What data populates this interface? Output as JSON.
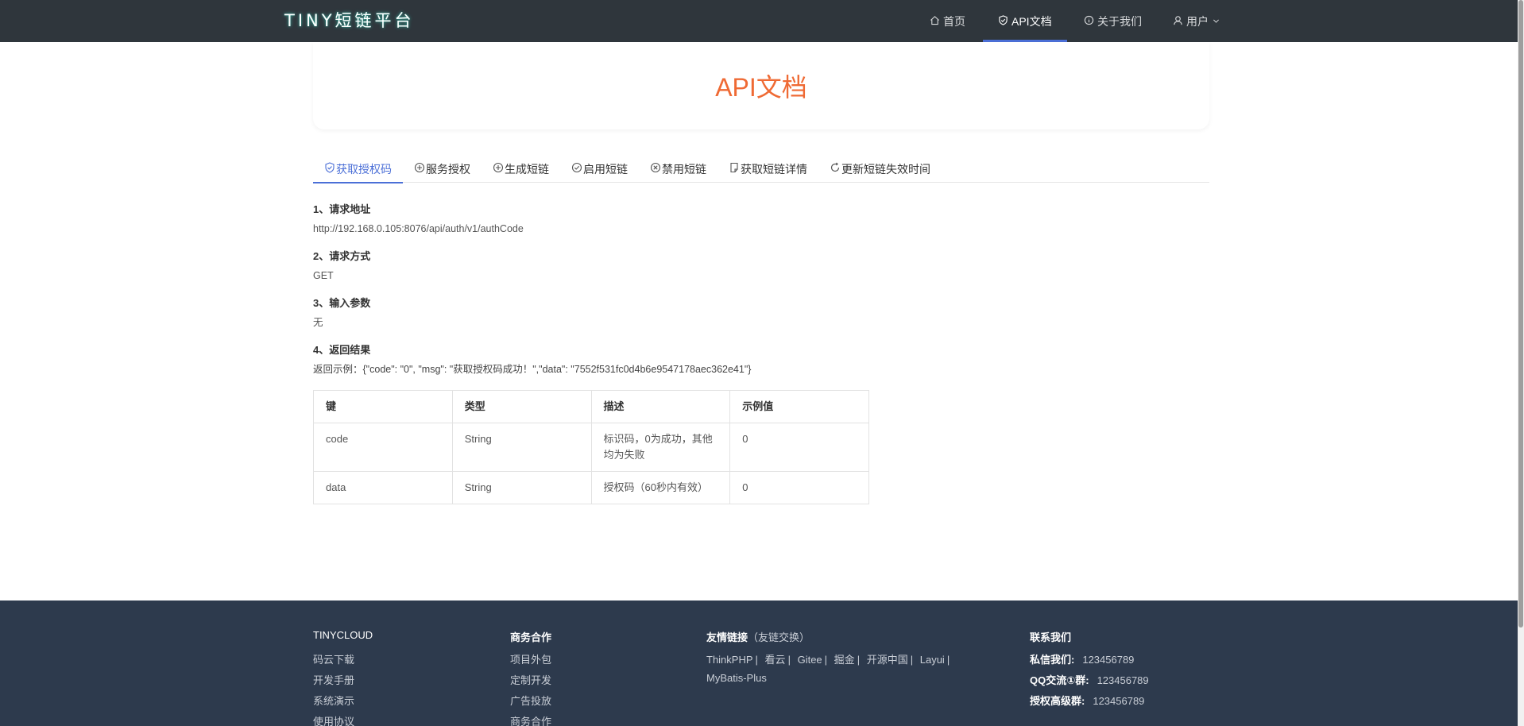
{
  "header": {
    "logo": "TINY短链平台",
    "nav": [
      {
        "label": "首页",
        "icon": "home-icon"
      },
      {
        "label": "API文档",
        "icon": "shield-check-icon",
        "active": true
      },
      {
        "label": "关于我们",
        "icon": "info-icon"
      },
      {
        "label": "用户",
        "icon": "user-icon"
      }
    ]
  },
  "page": {
    "title": "API文档"
  },
  "tabs": [
    {
      "label": "获取授权码",
      "icon": "shield-check-icon",
      "active": true
    },
    {
      "label": "服务授权",
      "icon": "plus-circle-icon"
    },
    {
      "label": "生成短链",
      "icon": "plus-circle-icon"
    },
    {
      "label": "启用短链",
      "icon": "check-circle-icon"
    },
    {
      "label": "禁用短链",
      "icon": "close-circle-icon"
    },
    {
      "label": "获取短链详情",
      "icon": "document-icon"
    },
    {
      "label": "更新短链失效时间",
      "icon": "refresh-icon"
    }
  ],
  "doc": {
    "s1_title": "1、请求地址",
    "s1_value": "http://192.168.0.105:8076/api/auth/v1/authCode",
    "s2_title": "2、请求方式",
    "s2_value": "GET",
    "s3_title": "3、输入参数",
    "s3_value": "无",
    "s4_title": "4、返回结果",
    "example": "返回示例：{\"code\": \"0\", \"msg\": \"获取授权码成功！\",\"data\": \"7552f531fc0d4b6e9547178aec362e41\"}"
  },
  "table": {
    "headers": [
      "键",
      "类型",
      "描述",
      "示例值"
    ],
    "rows": [
      [
        "code",
        "String",
        "标识码，0为成功，其他均为失败",
        "0"
      ],
      [
        "data",
        "String",
        "授权码（60秒内有效）",
        "0"
      ]
    ]
  },
  "footer": {
    "col1": {
      "title": "TINYCLOUD",
      "links": [
        "码云下载",
        "开发手册",
        "系统演示",
        "使用协议"
      ]
    },
    "col2": {
      "title": "商务合作",
      "links": [
        "项目外包",
        "定制开发",
        "广告投放",
        "商务合作"
      ]
    },
    "col3": {
      "title": "友情链接",
      "subtitle": "（友链交换）",
      "links": [
        "ThinkPHP",
        "看云",
        "Gitee",
        "掘金",
        "开源中国",
        "Layui",
        "MyBatis-Plus"
      ]
    },
    "col4": {
      "title": "联系我们",
      "items": [
        {
          "label": "私信我们:",
          "value": "123456789"
        },
        {
          "label": "QQ交流①群:",
          "value": "123456789"
        },
        {
          "label": "授权高级群:",
          "value": "123456789"
        }
      ]
    }
  }
}
